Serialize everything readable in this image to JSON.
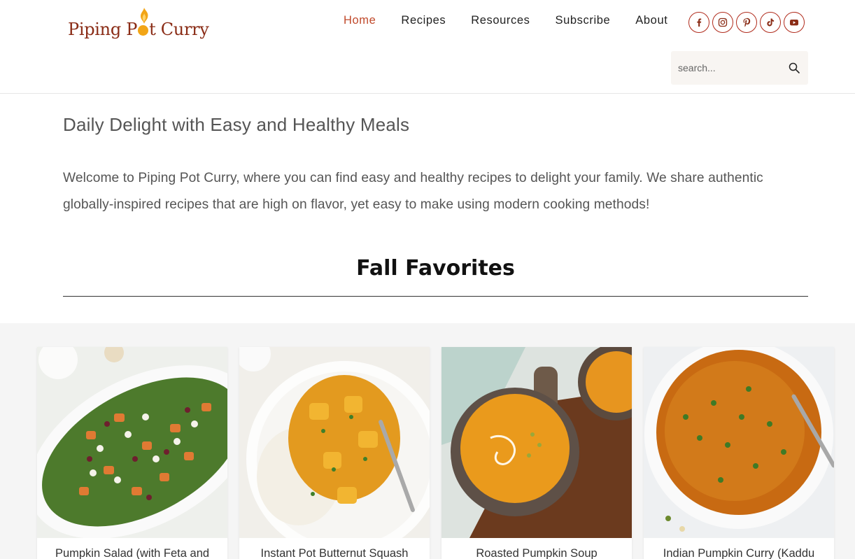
{
  "brand": {
    "logo_text_1": "Piping P",
    "logo_text_2": "t Curry",
    "logo_alt": "Piping Pot Curry"
  },
  "nav": {
    "items": [
      {
        "label": "Home",
        "active": true
      },
      {
        "label": "Recipes",
        "active": false
      },
      {
        "label": "Resources",
        "active": false
      },
      {
        "label": "Subscribe",
        "active": false
      },
      {
        "label": "About",
        "active": false
      }
    ]
  },
  "social": [
    {
      "name": "facebook-icon"
    },
    {
      "name": "instagram-icon"
    },
    {
      "name": "pinterest-icon"
    },
    {
      "name": "tiktok-icon"
    },
    {
      "name": "youtube-icon"
    }
  ],
  "search": {
    "placeholder": "search..."
  },
  "content": {
    "tagline": "Daily Delight with Easy and Healthy Meals",
    "intro": "Welcome to Piping Pot Curry, where you can find easy and healthy recipes to delight your family. We share authentic globally-inspired recipes that are high on flavor, yet easy to make using modern cooking methods!"
  },
  "section": {
    "title": "Fall Favorites"
  },
  "cards": [
    {
      "title": "Pumpkin Salad (with Feta and"
    },
    {
      "title": "Instant Pot Butternut Squash"
    },
    {
      "title": "Roasted Pumpkin Soup"
    },
    {
      "title": "Indian Pumpkin Curry (Kaddu"
    }
  ],
  "colors": {
    "accent": "#c0492b",
    "brand": "#8a2c16",
    "flame": "#f2a516"
  }
}
